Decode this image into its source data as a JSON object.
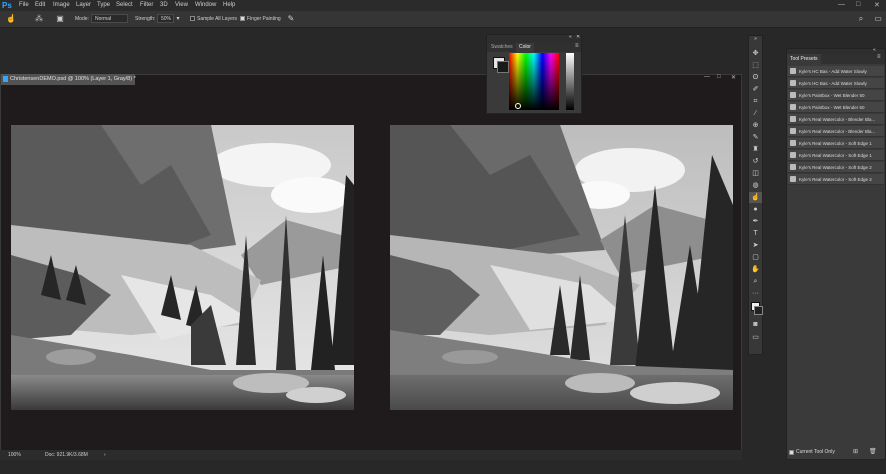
{
  "app": {
    "logo": "Ps"
  },
  "menu": [
    "File",
    "Edit",
    "Image",
    "Layer",
    "Type",
    "Select",
    "Filter",
    "3D",
    "View",
    "Window",
    "Help"
  ],
  "window_controls": {
    "minimize": "—",
    "maximize": "□",
    "close": "✕"
  },
  "options_bar": {
    "mode_label": "Mode:",
    "mode_value": "Normal",
    "strength_label": "Strength:",
    "strength_value": "50%",
    "sample_all_layers": "Sample All Layers",
    "sample_all_layers_checked": false,
    "finger_painting": "Finger Painting",
    "finger_painting_checked": true
  },
  "document": {
    "tab_title": "ChristensenDEMO.psd @ 100% (Layer 1, Gray/8) *",
    "status_zoom": "100%",
    "status_doc": "Doc: 921.9K/3.68M"
  },
  "color_panel": {
    "tabs": [
      "Swatches",
      "Color"
    ],
    "active_tab": "Color"
  },
  "tool_presets": {
    "title": "Tool Presets",
    "items": [
      "Kyle's HC Bas - Add Water Slowly",
      "Kyle's HC Bas - Add Water Slowly",
      "Kyle's Paintbox - Wet Blender 50",
      "Kyle's Paintbox - Wet Blender 50",
      "Kyle's Real Watercolor - Blender Bla...",
      "Kyle's Real Watercolor - Blender Bla...",
      "Kyle's Real Watercolor - Soft Edge 1",
      "Kyle's Real Watercolor - Soft Edge 1",
      "Kyle's Real Watercolor - Soft Edge 2",
      "Kyle's Real Watercolor - Soft Edge 2"
    ],
    "current_tool_only": "Current Tool Only",
    "current_tool_only_checked": true
  },
  "colors": {
    "accent": "#31a8ff",
    "canvas_bg": "#1f1a1c",
    "panel": "#3a3a3a"
  }
}
